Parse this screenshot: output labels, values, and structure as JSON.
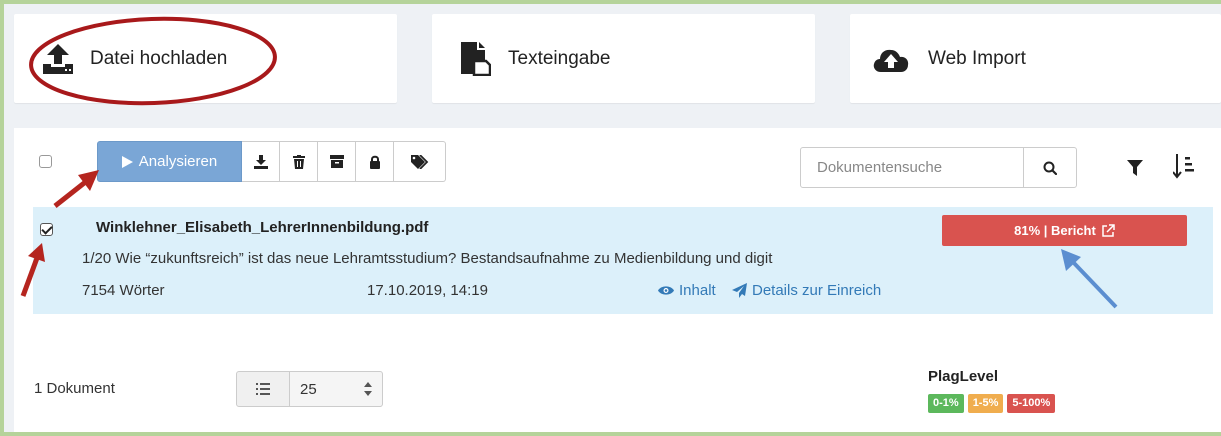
{
  "upload_options": [
    {
      "label": "Datei hochladen",
      "icon": "upload-tray-icon"
    },
    {
      "label": "Texteingabe",
      "icon": "file-text-icon"
    },
    {
      "label": "Web Import",
      "icon": "cloud-upload-icon"
    }
  ],
  "toolbar": {
    "analyze_label": "Analysieren",
    "icons": [
      "download-icon",
      "trash-icon",
      "archive-icon",
      "lock-icon",
      "tags-icon"
    ]
  },
  "search": {
    "placeholder": "Dokumentensuche",
    "icon": "search-icon"
  },
  "view_tools": {
    "filter_icon": "filter-icon",
    "sort_icon": "sort-icon"
  },
  "document": {
    "checked": true,
    "filename": "Winklehner_Elisabeth_LehrerInnenbildung.pdf",
    "description": "1/20 Wie “zukunftsreich” ist das neue Lehramtsstudium? Bestandsaufnahme zu Medienbildung und digit",
    "words": "7154  Wörter",
    "date": "17.10.2019, 14:19",
    "link_content": "Inhalt",
    "link_details": "Details zur Einreich",
    "report_label": "81% | Bericht",
    "report_color": "#d9534f"
  },
  "footer": {
    "doc_count": "1 Dokument",
    "page_size": "25"
  },
  "plag_level": {
    "title": "PlagLevel",
    "badges": [
      {
        "label": "0-1%",
        "color": "#5cb85c"
      },
      {
        "label": "1-5%",
        "color": "#f0ad4e"
      },
      {
        "label": "5-100%",
        "color": "#d9534f"
      }
    ]
  },
  "annotations": {
    "circle_color": "#a8191b",
    "red_arrow_color": "#b5251f",
    "blue_arrow_color": "#5b8ed0"
  }
}
